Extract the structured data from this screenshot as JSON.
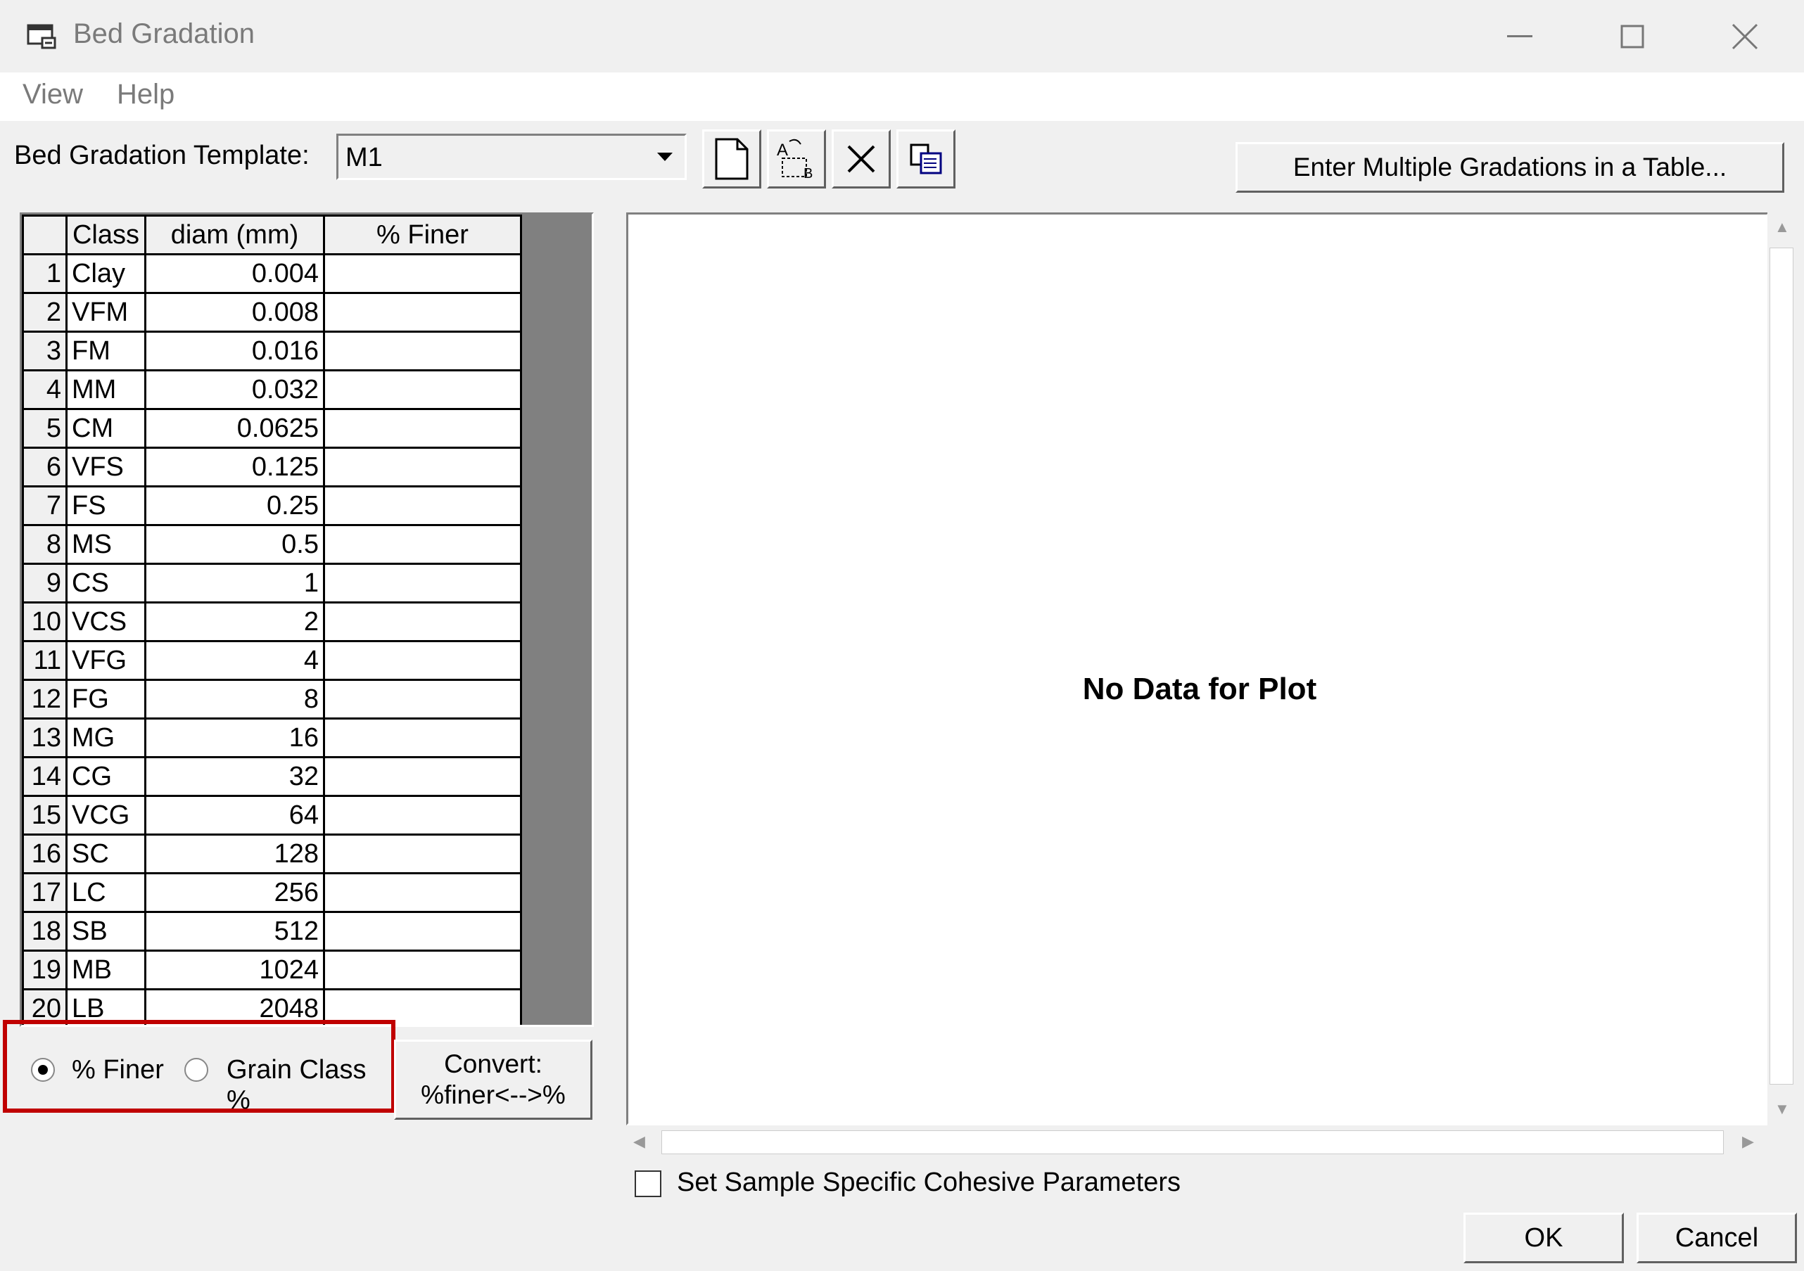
{
  "window": {
    "title": "Bed Gradation"
  },
  "menu": {
    "view": "View",
    "help": "Help"
  },
  "template": {
    "label": "Bed Gradation Template:",
    "value": "M1"
  },
  "toolbar": {
    "multi_button": "Enter Multiple Gradations in a Table..."
  },
  "grid": {
    "headers": {
      "class": "Class",
      "diam": "diam (mm)",
      "finer": "% Finer"
    },
    "rows": [
      {
        "n": "1",
        "cls": "Clay",
        "diam": "0.004",
        "finer": ""
      },
      {
        "n": "2",
        "cls": "VFM",
        "diam": "0.008",
        "finer": ""
      },
      {
        "n": "3",
        "cls": "FM",
        "diam": "0.016",
        "finer": ""
      },
      {
        "n": "4",
        "cls": "MM",
        "diam": "0.032",
        "finer": ""
      },
      {
        "n": "5",
        "cls": "CM",
        "diam": "0.0625",
        "finer": ""
      },
      {
        "n": "6",
        "cls": "VFS",
        "diam": "0.125",
        "finer": ""
      },
      {
        "n": "7",
        "cls": "FS",
        "diam": "0.25",
        "finer": ""
      },
      {
        "n": "8",
        "cls": "MS",
        "diam": "0.5",
        "finer": ""
      },
      {
        "n": "9",
        "cls": "CS",
        "diam": "1",
        "finer": ""
      },
      {
        "n": "10",
        "cls": "VCS",
        "diam": "2",
        "finer": ""
      },
      {
        "n": "11",
        "cls": "VFG",
        "diam": "4",
        "finer": ""
      },
      {
        "n": "12",
        "cls": "FG",
        "diam": "8",
        "finer": ""
      },
      {
        "n": "13",
        "cls": "MG",
        "diam": "16",
        "finer": ""
      },
      {
        "n": "14",
        "cls": "CG",
        "diam": "32",
        "finer": ""
      },
      {
        "n": "15",
        "cls": "VCG",
        "diam": "64",
        "finer": ""
      },
      {
        "n": "16",
        "cls": "SC",
        "diam": "128",
        "finer": ""
      },
      {
        "n": "17",
        "cls": "LC",
        "diam": "256",
        "finer": ""
      },
      {
        "n": "18",
        "cls": "SB",
        "diam": "512",
        "finer": ""
      },
      {
        "n": "19",
        "cls": "MB",
        "diam": "1024",
        "finer": ""
      },
      {
        "n": "20",
        "cls": "LB",
        "diam": "2048",
        "finer": ""
      }
    ]
  },
  "mode": {
    "finer_label": "% Finer",
    "class_label": "Grain Class %",
    "selected": "finer"
  },
  "convert": {
    "line1": "Convert:",
    "line2": "%finer<-->%"
  },
  "plot": {
    "message": "No Data for Plot"
  },
  "cohesive": {
    "label": "Set Sample Specific Cohesive Parameters",
    "checked": false
  },
  "buttons": {
    "ok": "OK",
    "cancel": "Cancel"
  }
}
